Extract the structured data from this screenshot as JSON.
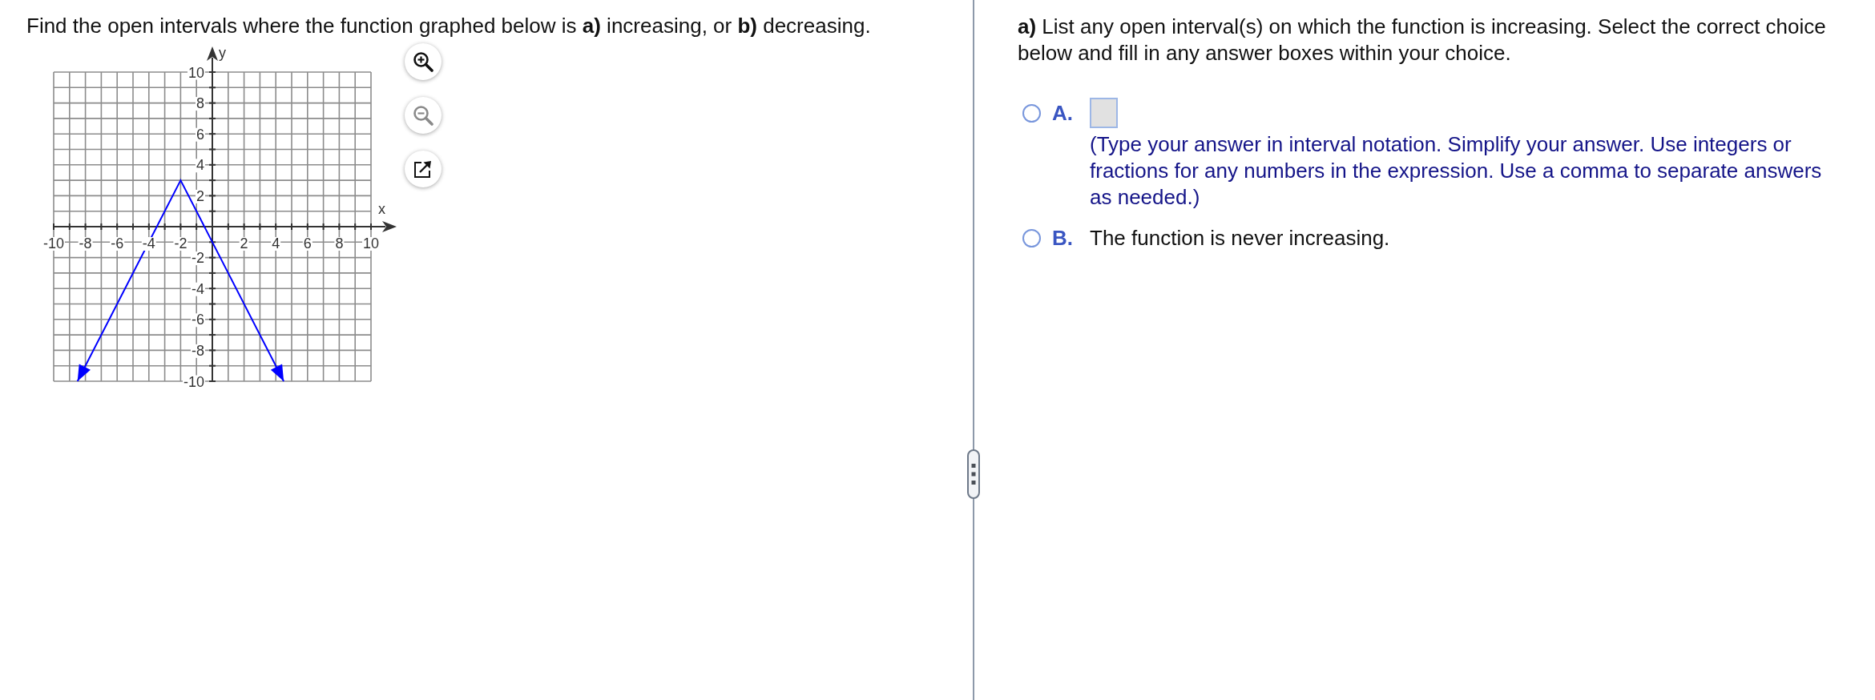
{
  "question": {
    "text": "Find the open intervals where the function graphed below is **a)** increasing, or **b)** decreasing."
  },
  "graph": {
    "chart_data": {
      "type": "line",
      "xlabel": "x",
      "ylabel": "y",
      "x": [
        -8.5,
        -2,
        4.5
      ],
      "series": [
        {
          "color": "#0000ff",
          "values": [
            -10,
            3,
            -10
          ]
        }
      ],
      "xlim": [
        -10,
        10
      ],
      "ylim": [
        -10,
        10
      ],
      "xticks": [
        -10,
        -8,
        -6,
        -4,
        -2,
        2,
        4,
        6,
        8,
        10
      ],
      "yticks": [
        -10,
        -8,
        -6,
        -4,
        -2,
        2,
        4,
        6,
        8,
        10
      ],
      "grid": true
    },
    "tools": [
      {
        "kind": "zoom_in",
        "disabled": false
      },
      {
        "kind": "zoom_out",
        "disabled": true
      },
      {
        "kind": "popout",
        "disabled": false
      }
    ]
  },
  "part_a": {
    "prompt": "**a)** List any open interval(s) on which the function is increasing. Select the correct choice below and fill in any answer boxes within your choice.",
    "choices": [
      {
        "kind": "answer_box",
        "letter": "A.",
        "selected": false,
        "note": "(Type your answer in interval notation. Simplify your answer. Use integers or fractions for any numbers in the expression. Use a comma to separate answers as needed.)"
      },
      {
        "kind": "statement",
        "letter": "B.",
        "selected": false,
        "text": "The function is never increasing."
      }
    ]
  }
}
